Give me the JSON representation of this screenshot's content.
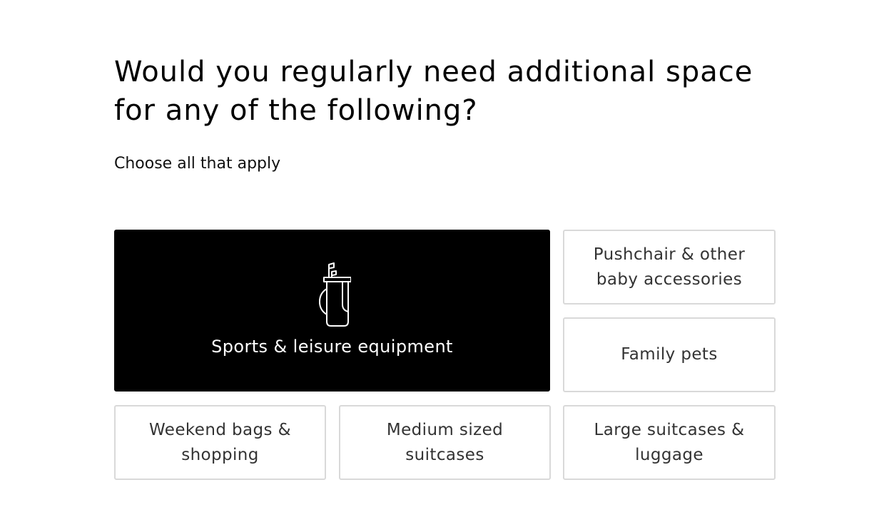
{
  "question": {
    "title": "Would you regularly need additional space for any of the following?",
    "hint": "Choose all that apply"
  },
  "options": [
    {
      "label": "Sports & leisure equipment",
      "selected": true,
      "icon": "golf-bag-icon"
    },
    {
      "label": "Pushchair & other baby accessories",
      "selected": false
    },
    {
      "label": "Family pets",
      "selected": false
    },
    {
      "label": "Weekend bags & shopping",
      "selected": false
    },
    {
      "label": "Medium sized suitcases",
      "selected": false
    },
    {
      "label": "Large suitcases & luggage",
      "selected": false
    }
  ],
  "colors": {
    "selected_background": "#000000",
    "selected_text": "#ffffff",
    "tile_border": "#d9d9d9",
    "tile_text": "#333333"
  }
}
